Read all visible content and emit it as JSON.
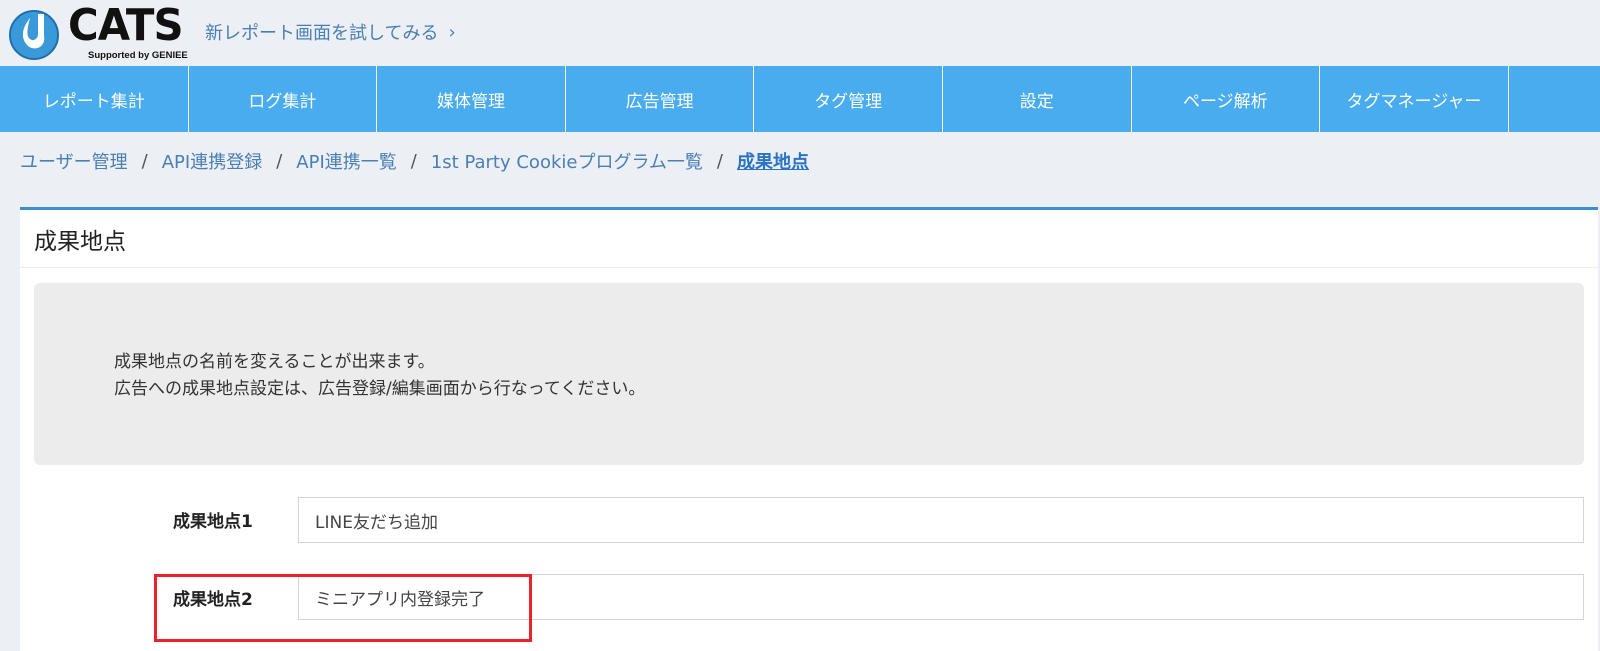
{
  "header": {
    "logo_text": "CATS",
    "logo_sub": "Supported by GENIEE",
    "try_new_report": "新レポート画面を試してみる",
    "try_chevron": "›"
  },
  "nav": {
    "items": [
      {
        "label": "レポート集計"
      },
      {
        "label": "ログ集計"
      },
      {
        "label": "媒体管理"
      },
      {
        "label": "広告管理"
      },
      {
        "label": "タグ管理"
      },
      {
        "label": "設定"
      },
      {
        "label": "ページ解析"
      },
      {
        "label": "タグマネージャー"
      }
    ]
  },
  "breadcrumb": {
    "sep": "/",
    "items": [
      {
        "label": "ユーザー管理"
      },
      {
        "label": "API連携登録"
      },
      {
        "label": "API連携一覧"
      },
      {
        "label": "1st Party Cookieプログラム一覧"
      },
      {
        "label": "成果地点"
      }
    ]
  },
  "panel": {
    "title": "成果地点",
    "info_line1": "成果地点の名前を変えることが出来ます。",
    "info_line2": "広告への成果地点設定は、広告登録/編集画面から行なってください。"
  },
  "fields": [
    {
      "label": "成果地点1",
      "value": "LINE友だち追加"
    },
    {
      "label": "成果地点2",
      "value": "ミニアプリ内登録完了"
    }
  ],
  "colors": {
    "nav_bg": "#49acef",
    "panel_accent": "#3b8fd1",
    "highlight": "#e8232a",
    "link": "#4a7fb5"
  }
}
